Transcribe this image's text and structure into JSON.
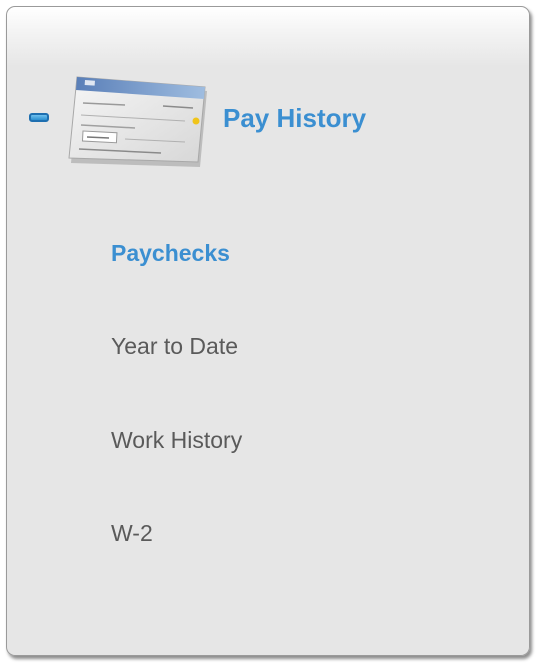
{
  "section": {
    "title": "Pay History",
    "icon": "paycheck-icon"
  },
  "nav": {
    "items": [
      {
        "label": "Paychecks",
        "active": true
      },
      {
        "label": "Year to Date",
        "active": false
      },
      {
        "label": "Work History",
        "active": false
      },
      {
        "label": "W-2",
        "active": false
      }
    ]
  },
  "colors": {
    "accent": "#3b8fd1",
    "text": "#5a5a5a",
    "panel": "#e6e6e6"
  }
}
